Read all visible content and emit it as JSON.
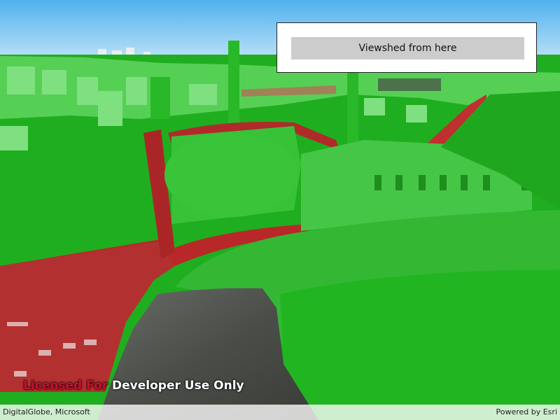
{
  "map": {
    "visible_color": "#00cc00",
    "obstructed_color": "#cc0000"
  },
  "panel": {
    "button_label": "Viewshed from here"
  },
  "license": {
    "licensed_for": "Licensed For",
    "developer_use": "Developer Use Only"
  },
  "attribution": {
    "left": "DigitalGlobe, Microsoft",
    "right": "Powered by Esri"
  }
}
